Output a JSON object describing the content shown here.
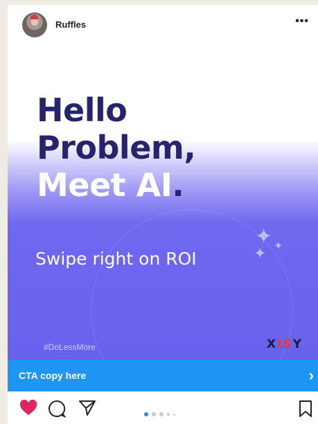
{
  "post": {
    "username": "Ruffles",
    "more_label": "•••",
    "headline": [
      "Hello",
      "Problem,",
      "Meet AI"
    ],
    "headline_dot": ".",
    "tagline": "Swipe right on ROI",
    "hashtag": "#DoLessMore",
    "brand": {
      "left": "X",
      "mid": "IS",
      "right": "Y"
    },
    "cta_label": "CTA copy here",
    "cta_chevron": "›",
    "carousel": {
      "total": 6,
      "current": 1
    }
  },
  "colors": {
    "accent": "#1d96f3",
    "headline_dark": "#26246e",
    "purple": "#6a61ee",
    "like_red": "#e0245e",
    "brand_red": "#e33a3a"
  },
  "icons": {
    "avatar": "avatar-image",
    "more": "more-icon",
    "like": "heart-icon",
    "comment": "comment-icon",
    "share": "send-icon",
    "save": "bookmark-icon",
    "sparkle": "sparkle-icon",
    "chevron": "chevron-right-icon"
  }
}
